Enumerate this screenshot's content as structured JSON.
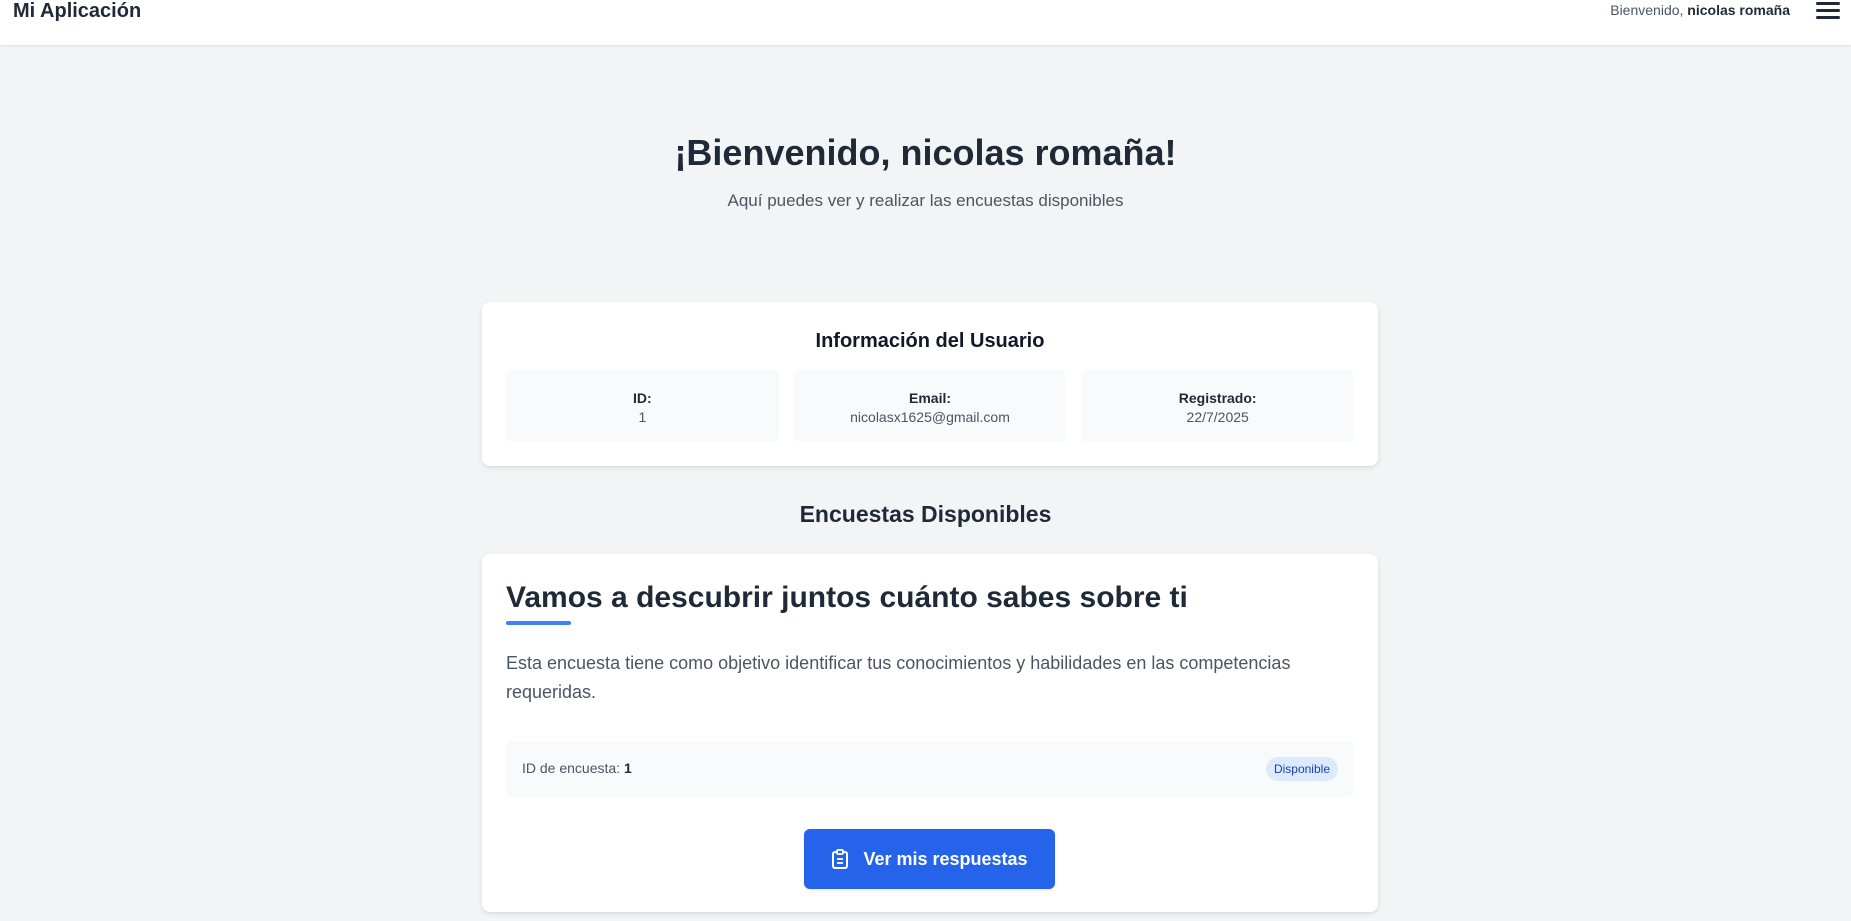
{
  "header": {
    "brand": "Mi Aplicación",
    "welcome_prefix": "Bienvenido,",
    "user_name": "nicolas romaña",
    "menu_icon": "hamburger-menu-icon"
  },
  "hero": {
    "title": "¡Bienvenido, nicolas romaña!",
    "subtitle": "Aquí puedes ver y realizar las encuestas disponibles"
  },
  "user_info": {
    "title": "Información del Usuario",
    "fields": [
      {
        "label": "ID:",
        "value": "1"
      },
      {
        "label": "Email:",
        "value": "nicolasx1625@gmail.com"
      },
      {
        "label": "Registrado:",
        "value": "22/7/2025"
      }
    ]
  },
  "surveys": {
    "section_title": "Encuestas Disponibles",
    "items": [
      {
        "title": "Vamos a descubrir juntos cuánto sabes sobre ti",
        "description": "Esta encuesta tiene como objetivo identificar tus conocimientos y habilidades en las competencias requeridas.",
        "id_label": "ID de encuesta:",
        "id_value": "1",
        "status": "Disponible",
        "button_label": "Ver mis respuestas",
        "button_icon": "clipboard-icon"
      }
    ]
  },
  "colors": {
    "primary": "#2563eb",
    "accent_underline": "#3b82f6",
    "badge_bg": "#dbeafe",
    "badge_text": "#1e40af",
    "page_bg": "#f3f4f6"
  }
}
